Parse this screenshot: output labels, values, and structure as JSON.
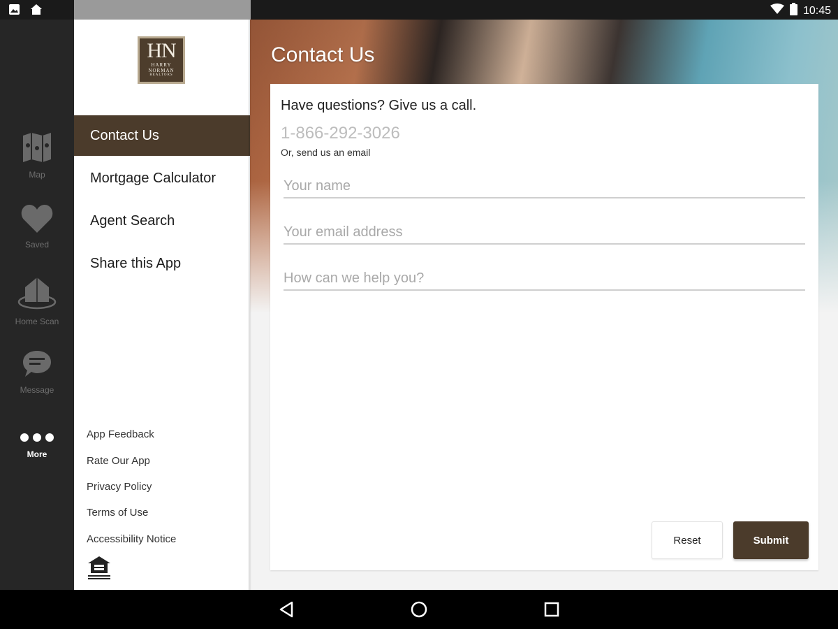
{
  "status_bar": {
    "time": "10:45",
    "left_icons": [
      "image-icon",
      "home-icon"
    ],
    "right_icons": [
      "wifi-icon",
      "battery-icon"
    ]
  },
  "rail": {
    "items": [
      {
        "label": "Map",
        "icon": "map-icon"
      },
      {
        "label": "Saved",
        "icon": "heart-icon"
      },
      {
        "label": "Home Scan",
        "icon": "house-scan-icon"
      },
      {
        "label": "Message",
        "icon": "chat-icon"
      },
      {
        "label": "More",
        "icon": "more-dots-icon",
        "active": true
      }
    ]
  },
  "drawer": {
    "logo": {
      "monogram": "HN",
      "line1": "HARRY",
      "line2": "NORMAN",
      "line3": "REALTORS"
    },
    "menu": [
      {
        "label": "Contact Us",
        "active": true
      },
      {
        "label": "Mortgage Calculator"
      },
      {
        "label": "Agent Search"
      },
      {
        "label": "Share this App"
      }
    ],
    "footer_links": [
      "App Feedback",
      "Rate Our App",
      "Privacy Policy",
      "Terms of Use",
      "Accessibility Notice"
    ],
    "footer_icon": "equal-housing-icon"
  },
  "main": {
    "title": "Contact Us",
    "heading": "Have questions? Give us a call.",
    "phone": "1-866-292-3026",
    "email_note": "Or, send us an email",
    "fields": {
      "name_placeholder": "Your name",
      "email_placeholder": "Your email address",
      "message_placeholder": "How can we help you?"
    },
    "buttons": {
      "reset": "Reset",
      "submit": "Submit"
    }
  },
  "nav_bar": {
    "icons": [
      "back-icon",
      "home-circle-icon",
      "recents-icon"
    ]
  },
  "colors": {
    "brand": "#4b3b2b",
    "rail_bg": "#262626",
    "page_bg": "#f3f3f3"
  }
}
